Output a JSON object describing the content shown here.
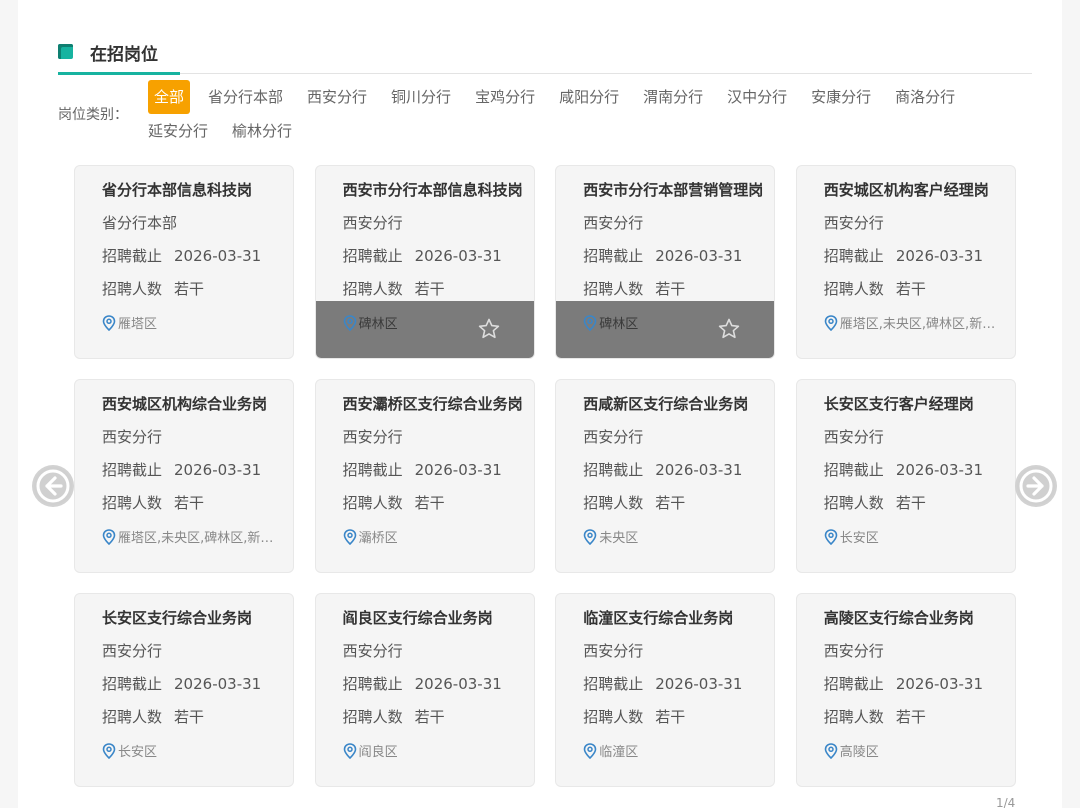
{
  "section": {
    "title": "在招岗位"
  },
  "filters": {
    "label": "岗位类别：",
    "items": [
      "全部",
      "省分行本部",
      "西安分行",
      "铜川分行",
      "宝鸡分行",
      "咸阳分行",
      "渭南分行",
      "汉中分行",
      "安康分行",
      "商洛分行",
      "延安分行",
      "榆林分行"
    ],
    "active": "全部"
  },
  "card_labels": {
    "deadline": "招聘截止",
    "count": "招聘人数"
  },
  "jobs": [
    {
      "title": "省分行本部信息科技岗",
      "branch": "省分行本部",
      "deadline": "2026-03-31",
      "count": "若干",
      "location": "雁塔区"
    },
    {
      "title": "西安市分行本部信息科技岗",
      "branch": "西安分行",
      "deadline": "2026-03-31",
      "count": "若干",
      "location": "碑林区"
    },
    {
      "title": "西安市分行本部营销管理岗",
      "branch": "西安分行",
      "deadline": "2026-03-31",
      "count": "若干",
      "location": "碑林区"
    },
    {
      "title": "西安城区机构客户经理岗",
      "branch": "西安分行",
      "deadline": "2026-03-31",
      "count": "若干",
      "location": "雁塔区,未央区,碑林区,新…"
    },
    {
      "title": "西安城区机构综合业务岗",
      "branch": "西安分行",
      "deadline": "2026-03-31",
      "count": "若干",
      "location": "雁塔区,未央区,碑林区,新…"
    },
    {
      "title": "西安灞桥区支行综合业务岗",
      "branch": "西安分行",
      "deadline": "2026-03-31",
      "count": "若干",
      "location": "灞桥区"
    },
    {
      "title": "西咸新区支行综合业务岗",
      "branch": "西安分行",
      "deadline": "2026-03-31",
      "count": "若干",
      "location": "未央区"
    },
    {
      "title": "长安区支行客户经理岗",
      "branch": "西安分行",
      "deadline": "2026-03-31",
      "count": "若干",
      "location": "长安区"
    },
    {
      "title": "长安区支行综合业务岗",
      "branch": "西安分行",
      "deadline": "2026-03-31",
      "count": "若干",
      "location": "长安区"
    },
    {
      "title": "阎良区支行综合业务岗",
      "branch": "西安分行",
      "deadline": "2026-03-31",
      "count": "若干",
      "location": "阎良区"
    },
    {
      "title": "临潼区支行综合业务岗",
      "branch": "西安分行",
      "deadline": "2026-03-31",
      "count": "若干",
      "location": "临潼区"
    },
    {
      "title": "高陵区支行综合业务岗",
      "branch": "西安分行",
      "deadline": "2026-03-31",
      "count": "若干",
      "location": "高陵区"
    }
  ],
  "pagination": {
    "indicator": "1/4"
  },
  "colors": {
    "accent": "#17b3a0",
    "active_filter": "#f7a100",
    "pin": "#3a86c8"
  }
}
